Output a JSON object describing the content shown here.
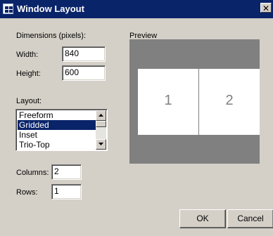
{
  "window": {
    "title": "Window Layout",
    "close_glyph": "✕"
  },
  "dimensions": {
    "label": "Dimensions (pixels):",
    "width_label": "Width:",
    "width_value": "840",
    "height_label": "Height:",
    "height_value": "600"
  },
  "layout": {
    "label": "Layout:",
    "options": [
      "Freeform",
      "Gridded",
      "Inset",
      "Trio-Top"
    ],
    "selected": "Gridded"
  },
  "grid": {
    "columns_label": "Columns:",
    "columns_value": "2",
    "rows_label": "Rows:",
    "rows_value": "1"
  },
  "preview": {
    "label": "Preview",
    "panes": [
      "1",
      "2"
    ]
  },
  "buttons": {
    "ok": "OK",
    "cancel": "Cancel"
  },
  "colors": {
    "title_bar": "#0a246a",
    "dialog_face": "#d4d0c8",
    "preview_bg": "#808080",
    "selection": "#0a246a"
  }
}
